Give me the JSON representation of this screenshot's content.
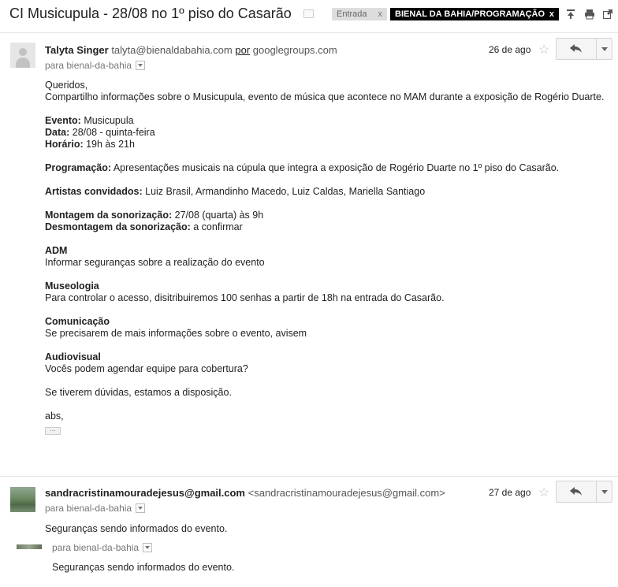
{
  "thread": {
    "subject": "CI Musicupula - 28/08 no 1º piso do Casarão",
    "labels": [
      {
        "text": "Entrada",
        "remove": "x"
      },
      {
        "text": "BIENAL DA BAHIA/PROGRAMAÇÃO",
        "remove": "x"
      }
    ]
  },
  "messages": [
    {
      "sender_name": "Talyta Singer",
      "sender_email": "talyta@bienaldabahia.com",
      "via_word": "por",
      "via_domain": "googlegroups.com",
      "to": "para bienal-da-bahia",
      "date": "26 de ago",
      "body": {
        "greeting": "Queridos,",
        "intro": "Compartilho informações sobre o Musicupula, evento de música que acontece no MAM durante a exposição de Rogério Duarte.",
        "evento_label": "Evento:",
        "evento_value": " Musicupula",
        "data_label": "Data:",
        "data_value": " 28/08 - quinta-feira",
        "horario_label": "Horário:",
        "horario_value": " 19h às 21h",
        "programacao_label": "Programação:",
        "programacao_value": " Apresentações musicais na cúpula que integra a exposição de Rogério Duarte no 1º piso do Casarão.",
        "artistas_label": "Artistas convidados:",
        "artistas_value": " Luiz Brasil, Armandinho Macedo, Luiz Caldas, Mariella Santiago",
        "montagem_label": "Montagem da sonorização:",
        "montagem_value": " 27/08 (quarta) às 9h",
        "desmontagem_label": "Desmontagem da sonorização:",
        "desmontagem_value": " a confirmar",
        "adm_title": "ADM",
        "adm_text": "Informar seguranças sobre a realização do evento",
        "museologia_title": "Museologia",
        "museologia_text": "Para controlar o acesso, disitribuiremos 100 senhas a partir de 18h na entrada do Casarão.",
        "comunicacao_title": "Comunicação",
        "comunicacao_text": "Se precisarem de mais informações sobre o evento, avisem",
        "audiovisual_title": "Audiovisual",
        "audiovisual_text": "Vocês podem agendar equipe para cobertura?",
        "closing": "Se tiverem dúvidas, estamos a disposição.",
        "signoff": "abs,",
        "trimmed": "..."
      }
    },
    {
      "sender_name": "sandracristinamouradejesus@gmail.com",
      "sender_email": "<sandracristinamouradejesus@gmail.com>",
      "to": "para bienal-da-bahia",
      "date": "27 de ago",
      "body": "Seguranças sendo informados do evento.",
      "quoted_to": "para bienal-da-bahia",
      "quoted_body": "Seguranças sendo informados do evento."
    }
  ]
}
